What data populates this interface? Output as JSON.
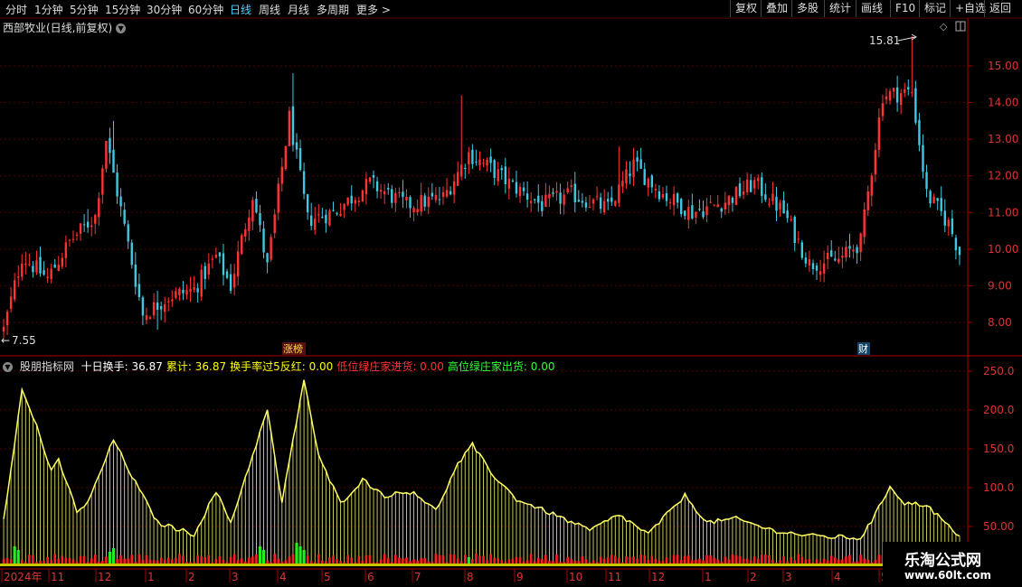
{
  "toolbar": {
    "left": [
      "分时",
      "1分钟",
      "5分钟",
      "15分钟",
      "30分钟",
      "60分钟",
      "日线",
      "周线",
      "月线",
      "多周期",
      "更多 >"
    ],
    "active": "日线",
    "right": [
      "复权",
      "叠加",
      "多股",
      "统计",
      "画线",
      "F10",
      "标记",
      "+自选",
      "返回"
    ]
  },
  "stock": {
    "title": "西部牧业(日线,前复权)"
  },
  "main_chart": {
    "y_ticks": [
      "15.00",
      "14.00",
      "13.00",
      "12.00",
      "11.00",
      "10.00",
      "9.00",
      "8.00"
    ],
    "high_label": "15.81",
    "low_label": "7.55",
    "event_zhangbang": "涨榜",
    "event_cai": "财"
  },
  "indicator": {
    "name": "股朋指标网",
    "items": [
      {
        "label": "十日换手: 36.87",
        "color": "#ffffff"
      },
      {
        "label": "累计: 36.87",
        "color": "#ffff00"
      },
      {
        "label": "换手率过5反红: 0.00",
        "color": "#ffff00"
      },
      {
        "label": "低位绿庄家进货: 0.00",
        "color": "#ff3333"
      },
      {
        "label": "高位绿庄家出货: 0.00",
        "color": "#33ff33"
      }
    ],
    "y_ticks": [
      "250.0",
      "200.0",
      "150.0",
      "100.0",
      "50.00"
    ]
  },
  "x_axis": {
    "labels": [
      "2024年",
      "11",
      "12",
      "1",
      "2",
      "3",
      "4",
      "5",
      "6",
      "7",
      "8",
      "9",
      "10",
      "11",
      "12",
      "1",
      "2",
      "3",
      "4",
      "5"
    ]
  },
  "watermark": {
    "line1": "乐淘公式网",
    "line2": "www.60lt.com"
  },
  "colors": {
    "up": "#ff3333",
    "down": "#40c8e0",
    "axis": "#aa0000",
    "line": "#ffff66"
  },
  "chart_data": {
    "type": "candlestick",
    "price_range": [
      7.4,
      16.0
    ],
    "turnover_range": [
      30,
      260
    ],
    "anchors_close": [
      [
        0,
        7.8
      ],
      [
        5,
        9.8
      ],
      [
        12,
        9.2
      ],
      [
        18,
        10.2
      ],
      [
        25,
        10.9
      ],
      [
        28,
        13.0
      ],
      [
        33,
        10.6
      ],
      [
        38,
        8.2
      ],
      [
        45,
        8.7
      ],
      [
        52,
        8.9
      ],
      [
        58,
        9.8
      ],
      [
        62,
        9.0
      ],
      [
        68,
        11.5
      ],
      [
        72,
        9.5
      ],
      [
        78,
        13.6
      ],
      [
        83,
        10.8
      ],
      [
        90,
        11.0
      ],
      [
        100,
        11.8
      ],
      [
        110,
        11.2
      ],
      [
        120,
        11.4
      ],
      [
        127,
        12.6
      ],
      [
        133,
        12.2
      ],
      [
        138,
        11.8
      ],
      [
        147,
        11.2
      ],
      [
        155,
        11.5
      ],
      [
        165,
        11.1
      ],
      [
        172,
        12.3
      ],
      [
        180,
        11.5
      ],
      [
        188,
        11.0
      ],
      [
        197,
        11.3
      ],
      [
        205,
        11.8
      ],
      [
        213,
        11.0
      ],
      [
        220,
        9.6
      ],
      [
        228,
        9.7
      ],
      [
        234,
        10.2
      ],
      [
        240,
        14.2
      ],
      [
        248,
        14.3
      ],
      [
        252,
        11.5
      ],
      [
        258,
        10.7
      ],
      [
        261,
        9.9
      ]
    ],
    "anchors_turnover": [
      [
        0,
        60
      ],
      [
        5,
        225
      ],
      [
        9,
        180
      ],
      [
        13,
        120
      ],
      [
        15,
        135
      ],
      [
        20,
        70
      ],
      [
        23,
        80
      ],
      [
        30,
        162
      ],
      [
        35,
        115
      ],
      [
        42,
        55
      ],
      [
        52,
        40
      ],
      [
        58,
        95
      ],
      [
        62,
        55
      ],
      [
        72,
        200
      ],
      [
        76,
        80
      ],
      [
        82,
        240
      ],
      [
        86,
        140
      ],
      [
        92,
        80
      ],
      [
        98,
        110
      ],
      [
        104,
        90
      ],
      [
        112,
        95
      ],
      [
        118,
        70
      ],
      [
        124,
        130
      ],
      [
        128,
        155
      ],
      [
        133,
        120
      ],
      [
        140,
        85
      ],
      [
        148,
        70
      ],
      [
        160,
        45
      ],
      [
        168,
        65
      ],
      [
        176,
        40
      ],
      [
        186,
        90
      ],
      [
        192,
        55
      ],
      [
        200,
        60
      ],
      [
        210,
        45
      ],
      [
        220,
        38
      ],
      [
        234,
        35
      ],
      [
        238,
        65
      ],
      [
        242,
        102
      ],
      [
        246,
        80
      ],
      [
        252,
        78
      ],
      [
        257,
        55
      ],
      [
        261,
        35
      ]
    ],
    "spikes_high": [
      [
        30,
        13.5
      ],
      [
        79,
        14.8
      ],
      [
        125,
        14.2
      ],
      [
        168,
        12.8
      ],
      [
        248,
        15.81
      ]
    ],
    "spikes_low": [
      [
        0,
        7.55
      ],
      [
        42,
        7.8
      ]
    ]
  }
}
